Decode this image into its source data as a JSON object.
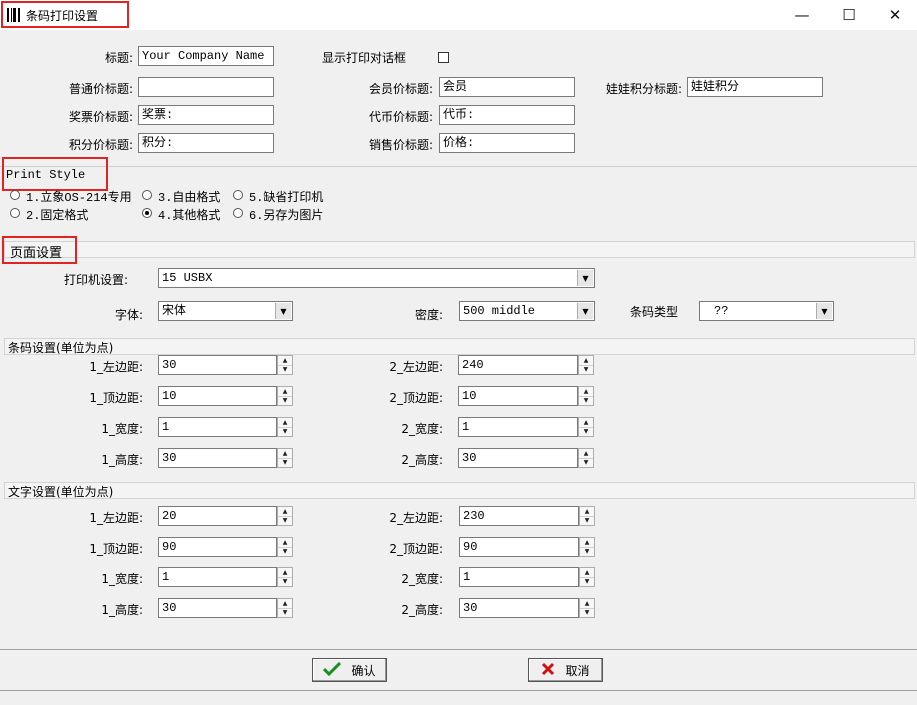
{
  "window": {
    "title": "条码打印设置",
    "icon": "barcode-icon",
    "controls": {
      "minimize": "—",
      "maximize": "☐",
      "close": "✕"
    }
  },
  "headings": {
    "title_label": "标题:",
    "title_value": "Your Company Name",
    "show_dialog_label": "显示打印对话框",
    "normal_price_label": "普通价标题:",
    "normal_price_value": "",
    "member_price_label": "会员价标题:",
    "member_price_value": "会员",
    "doll_points_label": "娃娃积分标题:",
    "doll_points_value": "娃娃积分",
    "lottery_price_label": "奖票价标题:",
    "lottery_price_value": "奖票:",
    "token_price_label": "代币价标题:",
    "token_price_value": "代币:",
    "points_price_label": "积分价标题:",
    "points_price_value": "积分:",
    "sale_price_label": "销售价标题:",
    "sale_price_value": "价格:"
  },
  "print_style": {
    "section_title": "Print Style",
    "options": [
      {
        "label": "1.立象OS-214专用",
        "selected": false
      },
      {
        "label": "2.固定格式",
        "selected": false
      },
      {
        "label": "3.自由格式",
        "selected": false
      },
      {
        "label": "4.其他格式",
        "selected": true
      },
      {
        "label": "5.缺省打印机",
        "selected": false
      },
      {
        "label": "6.另存为图片",
        "selected": false
      }
    ]
  },
  "page_setup": {
    "section_title": "页面设置",
    "printer_label": "打印机设置:",
    "printer_value": "15 USBX",
    "font_label": "字体:",
    "font_value": "宋体",
    "density_label": "密度:",
    "density_value": "500 middle",
    "barcode_type_label": "条码类型",
    "barcode_type_value": "??"
  },
  "barcode_settings": {
    "section_title": "条码设置(单位为点)",
    "left": [
      {
        "label": "1_左边距:",
        "value": "30"
      },
      {
        "label": "1_顶边距:",
        "value": "10"
      },
      {
        "label": "1_宽度:",
        "value": "1"
      },
      {
        "label": "1_高度:",
        "value": "30"
      }
    ],
    "right": [
      {
        "label": "2_左边距:",
        "value": "240"
      },
      {
        "label": "2_顶边距:",
        "value": "10"
      },
      {
        "label": "2_宽度:",
        "value": "1"
      },
      {
        "label": "2_高度:",
        "value": "30"
      }
    ]
  },
  "text_settings": {
    "section_title": "文字设置(单位为点)",
    "left": [
      {
        "label": "1_左边距:",
        "value": "20"
      },
      {
        "label": "1_顶边距:",
        "value": "90"
      },
      {
        "label": "1_宽度:",
        "value": "1"
      },
      {
        "label": "1_高度:",
        "value": "30"
      }
    ],
    "right": [
      {
        "label": "2_左边距:",
        "value": "230"
      },
      {
        "label": "2_顶边距:",
        "value": "90"
      },
      {
        "label": "2_宽度:",
        "value": "1"
      },
      {
        "label": "2_高度:",
        "value": "30"
      }
    ]
  },
  "buttons": {
    "ok_label": "确认",
    "cancel_label": "取消"
  },
  "colors": {
    "highlight": "#e02424",
    "ok_check": "#1a8f1a",
    "cancel_x": "#d01010"
  }
}
